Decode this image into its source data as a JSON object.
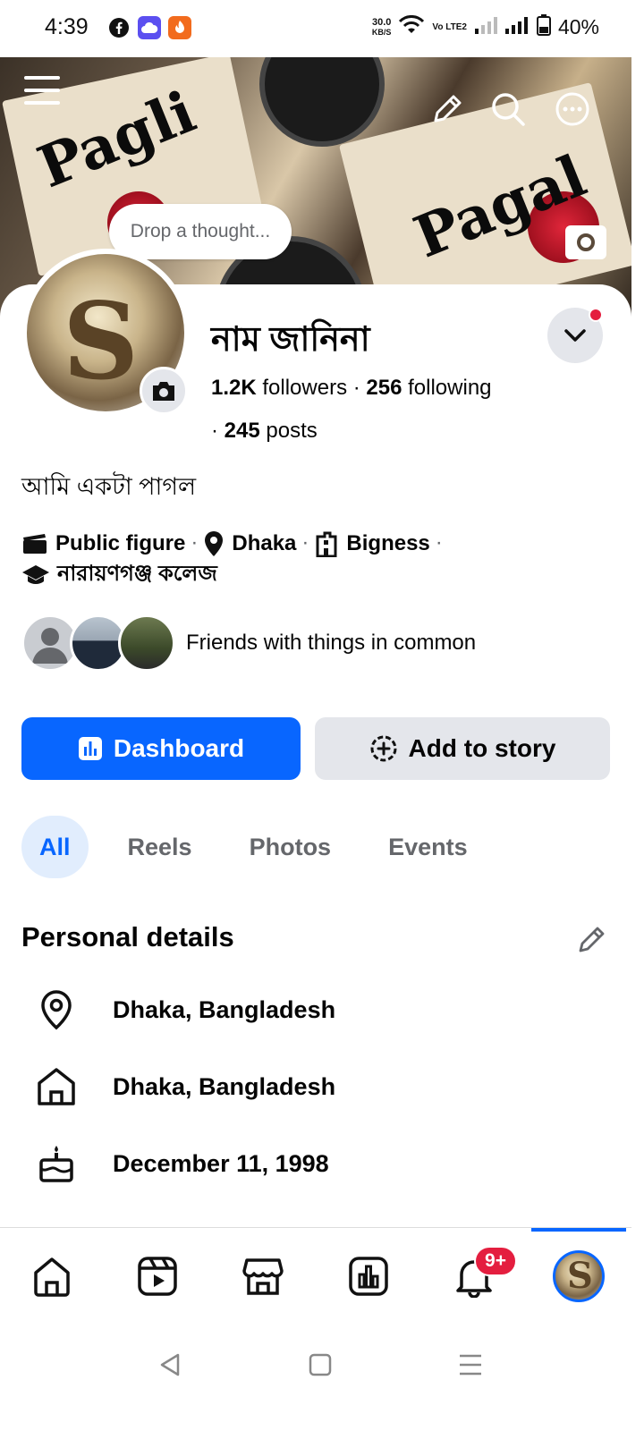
{
  "status_bar": {
    "time": "4:39",
    "net_speed_value": "30.0",
    "net_speed_unit": "KB/S",
    "volte": "Vo LTE2",
    "battery": "40%",
    "app_icons": [
      "facebook-icon",
      "cloud-app-icon",
      "orange-app-icon"
    ]
  },
  "cover": {
    "word_left": "Pagli",
    "word_right": "Pagal"
  },
  "thought_bubble": "Drop a thought...",
  "profile": {
    "name": "নাম জানিনা",
    "followers_count": "1.2K",
    "followers_label": " followers",
    "separator": " · ",
    "following_count": "256",
    "following_label": " following",
    "posts_prefix": "· ",
    "posts_count": "245",
    "posts_label": " posts",
    "bio": "আমি একটা পাগল"
  },
  "detail_chips": [
    {
      "icon": "clapperboard-icon",
      "label": "Public figure"
    },
    {
      "icon": "location-pin-icon",
      "label": "Dhaka"
    },
    {
      "icon": "building-icon",
      "label": "Bigness"
    },
    {
      "icon": "graduation-cap-icon",
      "label": "নারায়ণগঞ্জ কলেজ"
    }
  ],
  "friends": {
    "text": "Friends with things in common"
  },
  "actions": {
    "primary_label": "Dashboard",
    "secondary_label": "Add to story"
  },
  "tabs": [
    {
      "label": "All",
      "active": true
    },
    {
      "label": "Reels",
      "active": false
    },
    {
      "label": "Photos",
      "active": false
    },
    {
      "label": "Events",
      "active": false
    }
  ],
  "personal_details": {
    "title": "Personal details",
    "rows": [
      {
        "icon": "location-pin-icon",
        "text": "Dhaka, Bangladesh"
      },
      {
        "icon": "home-icon",
        "text": "Dhaka, Bangladesh"
      },
      {
        "icon": "birthday-cake-icon",
        "text": "December 11, 1998"
      }
    ]
  },
  "bottom_nav": {
    "items": [
      "home-icon",
      "reels-icon",
      "marketplace-icon",
      "dashboard-icon",
      "notifications-icon",
      "profile-avatar"
    ],
    "notification_badge": "9+",
    "active": "profile-avatar"
  },
  "colors": {
    "accent": "#0866ff",
    "badge": "#e41e3f",
    "secondary_button": "#e4e6eb",
    "tab_active_bg": "#e1edfd"
  }
}
